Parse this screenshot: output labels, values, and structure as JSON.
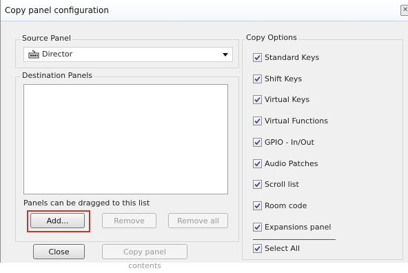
{
  "window": {
    "title": "Copy panel configuration"
  },
  "source": {
    "group_label": "Source Panel",
    "selected": "Director",
    "icon": "panel-icon"
  },
  "destination": {
    "group_label": "Destination Panels",
    "items": [],
    "hint": "Panels can be dragged to this list",
    "add_label": "Add...",
    "remove_label": "Remove",
    "remove_all_label": "Remove all"
  },
  "footer": {
    "close_label": "Close",
    "copy_label": "Copy panel contents"
  },
  "options": {
    "group_label": "Copy Options",
    "items": [
      {
        "label": "Standard Keys",
        "checked": true
      },
      {
        "label": "Shift Keys",
        "checked": true
      },
      {
        "label": "Virtual Keys",
        "checked": true
      },
      {
        "label": "Virtual Functions",
        "checked": true
      },
      {
        "label": "GPIO - In/Out",
        "checked": true
      },
      {
        "label": "Audio Patches",
        "checked": true
      },
      {
        "label": "Scroll list",
        "checked": true
      },
      {
        "label": "Room code",
        "checked": true
      },
      {
        "label": "Expansions panel",
        "checked": true
      }
    ],
    "select_all": {
      "label": "Select All",
      "checked": true
    }
  },
  "colors": {
    "highlight": "#c0392b",
    "accent": "#2f3f80"
  }
}
